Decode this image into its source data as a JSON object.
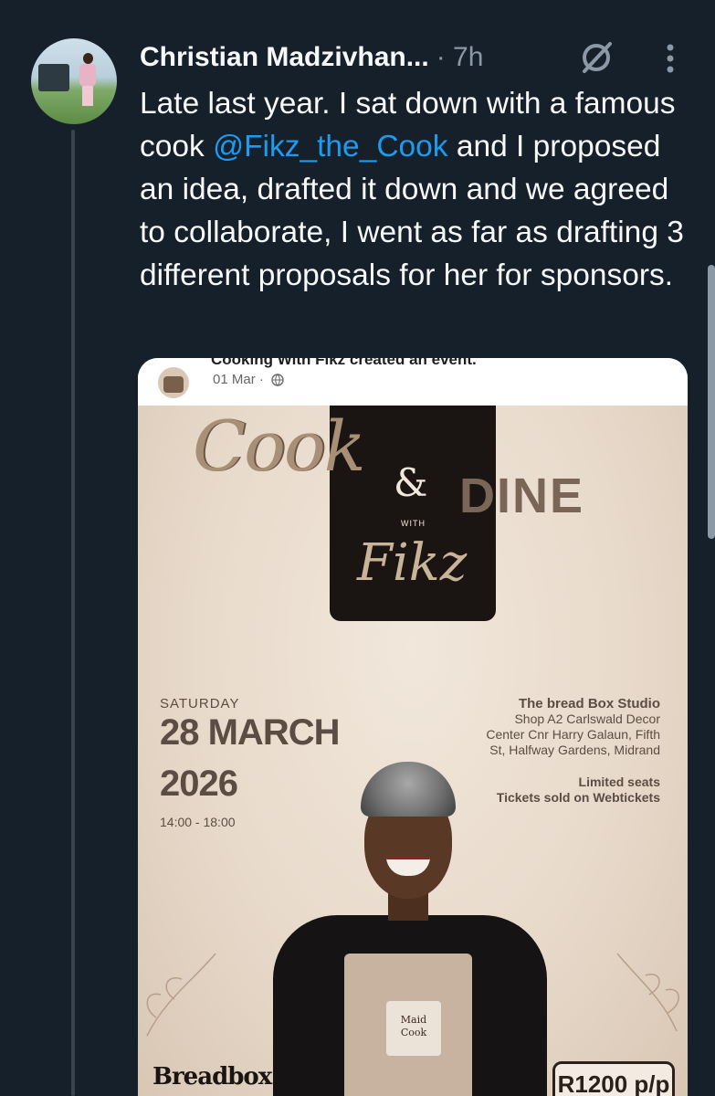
{
  "tweet": {
    "author": "Christian Madzivhan...",
    "separator_time": "· 7h",
    "text_before": "Late last year. I sat down with a famous cook ",
    "mention": "@Fikz_the_Cook",
    "text_after": " and I proposed an idea, drafted it down and we agreed to collaborate, I went as far as drafting 3 different proposals for her for sponsors.",
    "icons": [
      "grok-icon",
      "more-options-icon"
    ]
  },
  "embedded_post": {
    "line1": "Cooking With Fikz created an event.",
    "date": "01 Mar ·",
    "poster": {
      "cook": "Cook",
      "ampersand": "&",
      "with": "WITH",
      "dine": "DINE",
      "fikz": "Fikz",
      "day": "SATURDAY",
      "date_line1": "28 MARCH",
      "date_line2": "2026",
      "time": "14:00 - 18:00",
      "venue_title": "The bread Box Studio",
      "venue_line1": "Shop A2 Carlswald Decor",
      "venue_line2": "Center Cnr Harry Galaun, Fifth",
      "venue_line3": "St, Halfway Gardens, Midrand",
      "seats_line1": "Limited seats",
      "seats_line2": "Tickets sold on Webtickets",
      "apron_text1": "Maid",
      "apron_text2": "Cook",
      "brand": "Breadbox",
      "price": "R1200 p/p"
    }
  }
}
